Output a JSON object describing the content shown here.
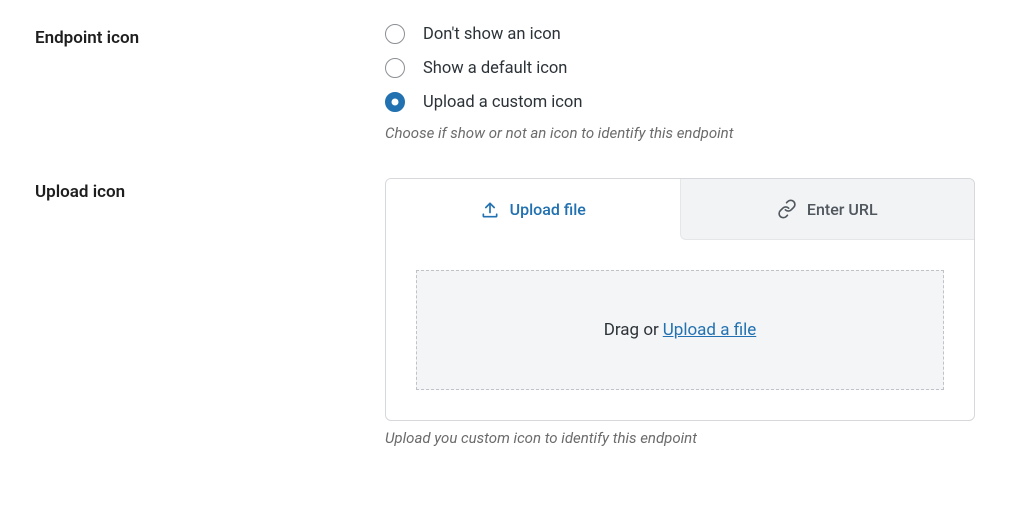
{
  "endpoint_icon": {
    "label": "Endpoint icon",
    "options": [
      {
        "label": "Don't show an icon",
        "selected": false
      },
      {
        "label": "Show a default icon",
        "selected": false
      },
      {
        "label": "Upload a custom icon",
        "selected": true
      }
    ],
    "helper": "Choose if show or not an icon to identify this endpoint"
  },
  "upload_icon": {
    "label": "Upload icon",
    "tabs": {
      "upload_file": "Upload file",
      "enter_url": "Enter URL"
    },
    "dropzone_text": "Drag or",
    "dropzone_link": "Upload a file",
    "helper": "Upload you custom icon to identify this endpoint"
  }
}
